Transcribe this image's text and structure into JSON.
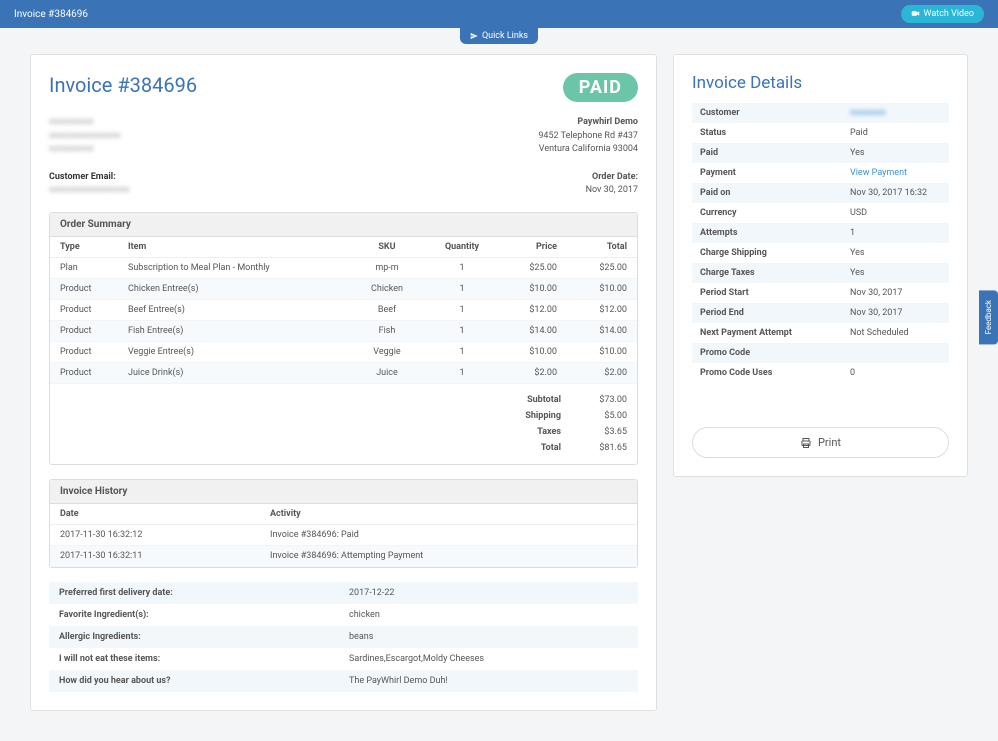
{
  "topbar": {
    "title": "Invoice #384696",
    "watch_video": "Watch Video"
  },
  "quicklinks": "Quick Links",
  "invoice": {
    "title": "Invoice #384696",
    "paid_stamp": "PAID",
    "customer_email_label": "Customer Email:",
    "company": {
      "name": "Paywhirl Demo",
      "addr1": "9452 Telephone Rd #437",
      "addr2": "Ventura California 93004"
    },
    "order_date_label": "Order Date:",
    "order_date": "Nov 30, 2017"
  },
  "order_summary": {
    "title": "Order Summary",
    "headers": {
      "type": "Type",
      "item": "Item",
      "sku": "SKU",
      "qty": "Quantity",
      "price": "Price",
      "total": "Total"
    },
    "rows": [
      {
        "type": "Plan",
        "item": "Subscription to Meal Plan - Monthly",
        "sku": "mp-m",
        "qty": "1",
        "price": "$25.00",
        "total": "$25.00"
      },
      {
        "type": "Product",
        "item": "Chicken Entree(s)",
        "sku": "Chicken",
        "qty": "1",
        "price": "$10.00",
        "total": "$10.00"
      },
      {
        "type": "Product",
        "item": "Beef Entree(s)",
        "sku": "Beef",
        "qty": "1",
        "price": "$12.00",
        "total": "$12.00"
      },
      {
        "type": "Product",
        "item": "Fish Entree(s)",
        "sku": "Fish",
        "qty": "1",
        "price": "$14.00",
        "total": "$14.00"
      },
      {
        "type": "Product",
        "item": "Veggie Entree(s)",
        "sku": "Veggie",
        "qty": "1",
        "price": "$10.00",
        "total": "$10.00"
      },
      {
        "type": "Product",
        "item": "Juice Drink(s)",
        "sku": "Juice",
        "qty": "1",
        "price": "$2.00",
        "total": "$2.00"
      }
    ],
    "totals": {
      "subtotal_lbl": "Subtotal",
      "subtotal": "$73.00",
      "shipping_lbl": "Shipping",
      "shipping": "$5.00",
      "taxes_lbl": "Taxes",
      "taxes": "$3.65",
      "total_lbl": "Total",
      "total": "$81.65"
    }
  },
  "history": {
    "title": "Invoice History",
    "headers": {
      "date": "Date",
      "activity": "Activity"
    },
    "rows": [
      {
        "date": "2017-11-30 16:32:12",
        "activity": "Invoice #384696: Paid"
      },
      {
        "date": "2017-11-30 16:32:11",
        "activity": "Invoice #384696: Attempting Payment"
      }
    ]
  },
  "custom_fields": [
    {
      "label": "Preferred first delivery date:",
      "value": "2017-12-22"
    },
    {
      "label": "Favorite Ingredient(s):",
      "value": "chicken"
    },
    {
      "label": "Allergic Ingredients:",
      "value": "beans"
    },
    {
      "label": "I will not eat these items:",
      "value": "Sardines,Escargot,Moldy Cheeses"
    },
    {
      "label": "How did you hear about us?",
      "value": "The PayWhirl Demo Duh!"
    }
  ],
  "details": {
    "title": "Invoice Details",
    "rows": [
      {
        "k": "Customer",
        "v": "",
        "link": true,
        "blur": true
      },
      {
        "k": "Status",
        "v": "Paid"
      },
      {
        "k": "Paid",
        "v": "Yes"
      },
      {
        "k": "Payment",
        "v": "View Payment",
        "link": true
      },
      {
        "k": "Paid on",
        "v": "Nov 30, 2017 16:32"
      },
      {
        "k": "Currency",
        "v": "USD"
      },
      {
        "k": "Attempts",
        "v": "1"
      },
      {
        "k": "Charge Shipping",
        "v": "Yes"
      },
      {
        "k": "Charge Taxes",
        "v": "Yes"
      },
      {
        "k": "Period Start",
        "v": "Nov 30, 2017"
      },
      {
        "k": "Period End",
        "v": "Nov 30, 2017"
      },
      {
        "k": "Next Payment Attempt",
        "v": "Not Scheduled"
      },
      {
        "k": "Promo Code",
        "v": ""
      },
      {
        "k": "Promo Code Uses",
        "v": "0"
      }
    ],
    "print": "Print"
  },
  "feedback": "Feedback"
}
